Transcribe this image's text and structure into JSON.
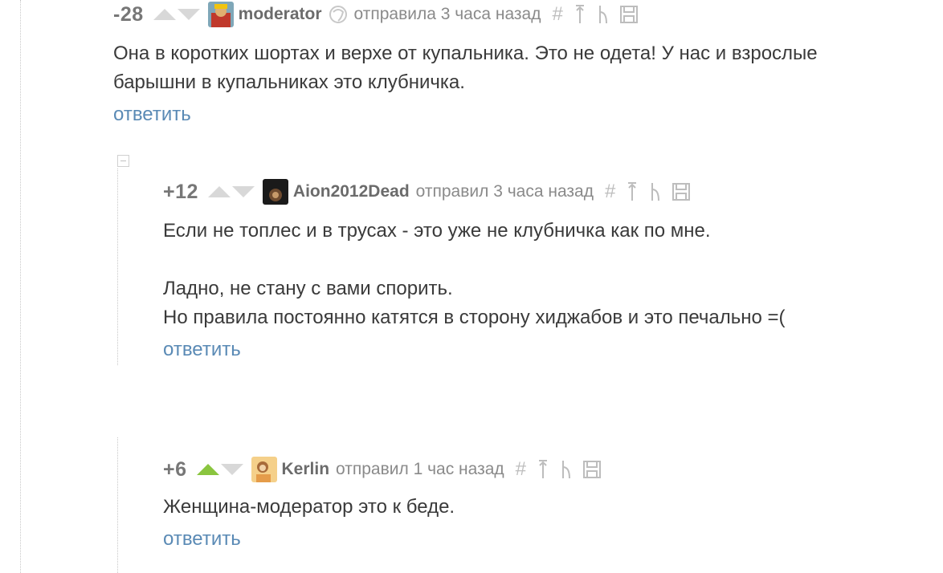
{
  "comments": [
    {
      "rating": "-28",
      "username": "moderator",
      "sent": "отправила 3 часа назад",
      "lines": [
        "Она в коротких шортах и верхе от купальника. Это не одета! У нас и взрослые",
        "барышни в купальниках это клубничка."
      ],
      "reply": "ответить"
    },
    {
      "rating": "+12",
      "username": "Aion2012Dead",
      "sent": "отправил 3 часа назад",
      "lines": [
        "Если не топлес и в трусах - это уже не клубничка как по мне.",
        "",
        "Ладно, не стану с вами спорить.",
        "Но правила постоянно катятся в сторону хиджабов и это печально =("
      ],
      "reply": "ответить"
    },
    {
      "rating": "+6",
      "username": "Kerlin",
      "sent": "отправил 1 час назад",
      "lines": [
        "Женщина-модератор это к беде."
      ],
      "reply": "ответить"
    }
  ],
  "tools": {
    "link": "#"
  },
  "colors": {
    "vote_active": "#8ac53f",
    "vote_inactive": "#d8d8d8",
    "reply_link": "#5a8ab5"
  },
  "icons": [
    "link-icon",
    "parent-arrow-icon",
    "branch-icon",
    "save-icon",
    "female-icon"
  ]
}
